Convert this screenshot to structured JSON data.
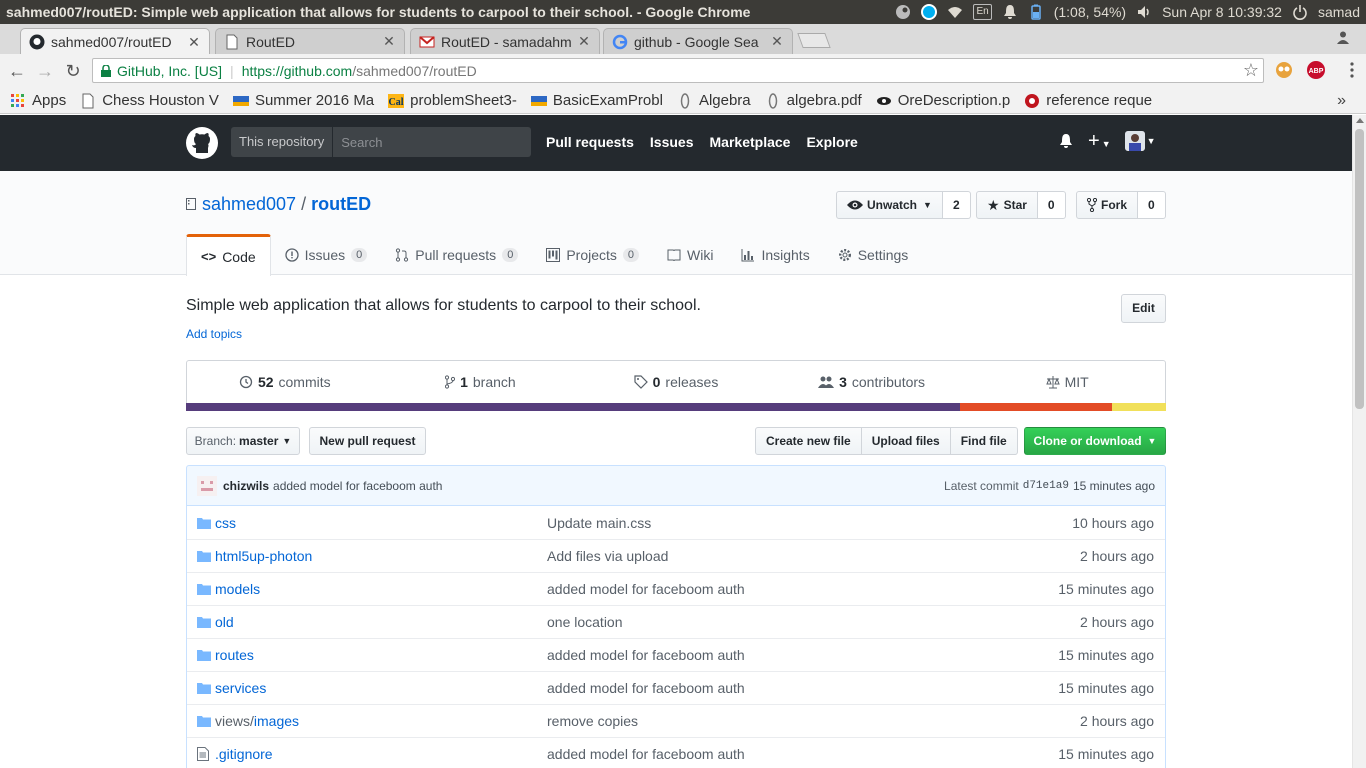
{
  "os": {
    "window_title": "sahmed007/routED: Simple web application that allows for students to carpool to their school. - Google Chrome",
    "keyboard": "En",
    "battery": "(1:08, 54%)",
    "clock": "Sun Apr  8 10:39:32",
    "user": "samad"
  },
  "tabs": [
    {
      "label": "sahmed007/routED",
      "icon": "github-icon"
    },
    {
      "label": "RoutED",
      "icon": "page-icon"
    },
    {
      "label": "RoutED - samadahm",
      "icon": "gmail-icon"
    },
    {
      "label": "github - Google Sea",
      "icon": "google-icon"
    }
  ],
  "omnibox": {
    "secure_label": "GitHub, Inc. [US]",
    "url_scheme_host": "https://github.com",
    "url_path": "/sahmed007/routED"
  },
  "bookmarks": [
    {
      "label": "Apps",
      "icon": "apps-grid-icon"
    },
    {
      "label": "Chess Houston V",
      "icon": "page-icon"
    },
    {
      "label": "Summer 2016 Ma",
      "icon": "ucla-icon"
    },
    {
      "label": "problemSheet3-",
      "icon": "cal-icon"
    },
    {
      "label": "BasicExamProbl",
      "icon": "ucla-icon"
    },
    {
      "label": "Algebra",
      "icon": "leaf-icon"
    },
    {
      "label": "algebra.pdf",
      "icon": "leaf-icon"
    },
    {
      "label": "OreDescription.p",
      "icon": "eye-icon"
    },
    {
      "label": "reference reque",
      "icon": "gear-red-icon"
    }
  ],
  "bookmarks_more": "»",
  "gh_header": {
    "scope": "This repository",
    "search_placeholder": "Search",
    "nav": [
      "Pull requests",
      "Issues",
      "Marketplace",
      "Explore"
    ]
  },
  "repo": {
    "owner": "sahmed007",
    "name": "routED",
    "watch_label": "Unwatch",
    "watch_count": "2",
    "star_label": "Star",
    "star_count": "0",
    "fork_label": "Fork",
    "fork_count": "0",
    "tabs": [
      {
        "label": "Code",
        "count": null
      },
      {
        "label": "Issues",
        "count": "0"
      },
      {
        "label": "Pull requests",
        "count": "0"
      },
      {
        "label": "Projects",
        "count": "0"
      },
      {
        "label": "Wiki",
        "count": null
      },
      {
        "label": "Insights",
        "count": null
      },
      {
        "label": "Settings",
        "count": null
      }
    ],
    "description": "Simple web application that allows for students to carpool to their school.",
    "add_topics": "Add topics",
    "edit_label": "Edit"
  },
  "summary": {
    "commits_num": "52",
    "commits_label": "commits",
    "branch_num": "1",
    "branch_label": "branch",
    "releases_num": "0",
    "releases_label": "releases",
    "contributors_num": "3",
    "contributors_label": "contributors",
    "license": "MIT",
    "languages": [
      {
        "percent": 79,
        "color": "#563d7c"
      },
      {
        "percent": 15.5,
        "color": "#e34c26"
      },
      {
        "percent": 5.5,
        "color": "#f1e05a"
      }
    ]
  },
  "file_nav": {
    "branch_prefix": "Branch:",
    "branch_name": "master",
    "new_pr": "New pull request",
    "create_file": "Create new file",
    "upload": "Upload files",
    "find": "Find file",
    "clone": "Clone or download"
  },
  "commit": {
    "author": "chizwils",
    "message": "added model for faceboom auth",
    "latest_label": "Latest commit",
    "sha": "d71e1a9",
    "time": "15 minutes ago"
  },
  "files": [
    {
      "type": "dir",
      "name": "css",
      "prefix": "",
      "message": "Update main.css",
      "age": "10 hours ago"
    },
    {
      "type": "dir",
      "name": "html5up-photon",
      "prefix": "",
      "message": "Add files via upload",
      "age": "2 hours ago"
    },
    {
      "type": "dir",
      "name": "models",
      "prefix": "",
      "message": "added model for faceboom auth",
      "age": "15 minutes ago"
    },
    {
      "type": "dir",
      "name": "old",
      "prefix": "",
      "message": "one location",
      "age": "2 hours ago"
    },
    {
      "type": "dir",
      "name": "routes",
      "prefix": "",
      "message": "added model for faceboom auth",
      "age": "15 minutes ago"
    },
    {
      "type": "dir",
      "name": "services",
      "prefix": "",
      "message": "added model for faceboom auth",
      "age": "15 minutes ago"
    },
    {
      "type": "dir",
      "name": "images",
      "prefix": "views/",
      "message": "remove copies",
      "age": "2 hours ago"
    },
    {
      "type": "file",
      "name": ".gitignore",
      "prefix": "",
      "message": "added model for faceboom auth",
      "age": "15 minutes ago"
    }
  ],
  "colors": {
    "gh_header": "#24292e",
    "link": "#0366d6",
    "green_button": "#28a745",
    "active_tab_accent": "#e36209"
  }
}
